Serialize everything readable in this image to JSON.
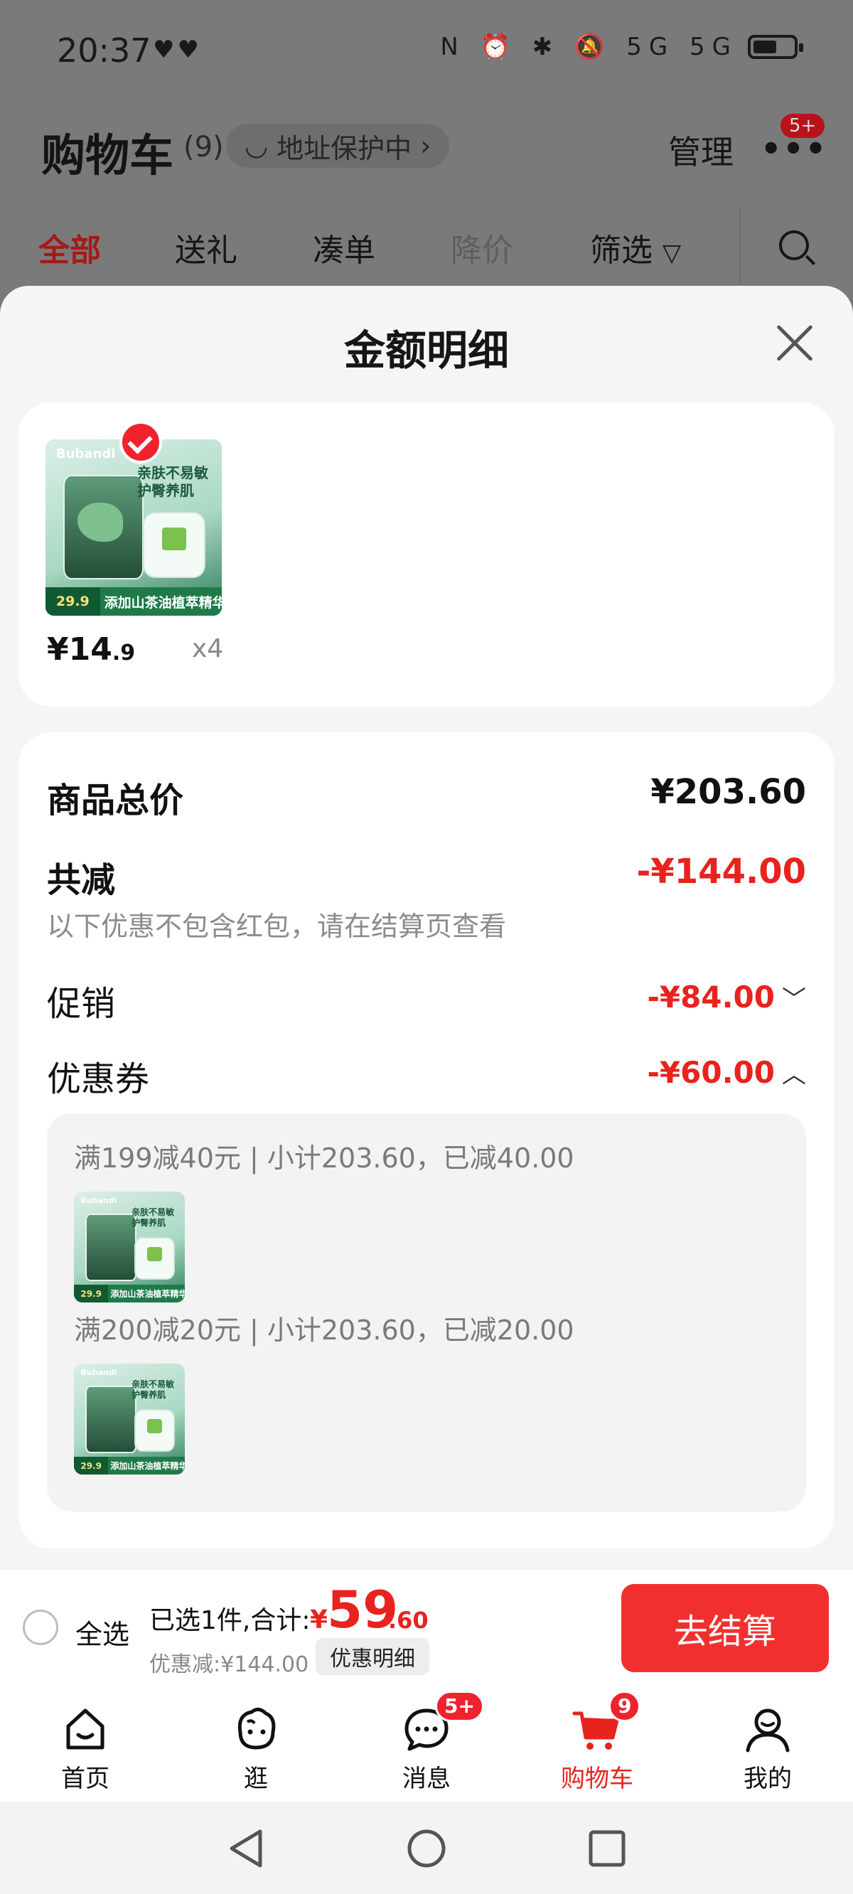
{
  "status_bar": {
    "time": "20:37",
    "hearts": "♥♥",
    "icons": "N ⏰ ✱ 🔕 5G 5G"
  },
  "header": {
    "title": "购物车",
    "count": "(9)",
    "address_pill": "地址保护中",
    "manage": "管理",
    "more_badge": "5+"
  },
  "filter_tabs": [
    {
      "label": "全部"
    },
    {
      "label": "送礼"
    },
    {
      "label": "凑单"
    },
    {
      "label": "降价"
    },
    {
      "label": "筛选"
    }
  ],
  "sheet": {
    "title": "金额明细",
    "product": {
      "brand": "Bubandi",
      "promo_text": "亲肤不易敏 护臀养肌",
      "bar_price": "29.9",
      "bar_text": "添加山茶油植萃精华",
      "price_int": "¥14",
      "price_dec": ".9",
      "qty": "x4"
    },
    "summary": {
      "total_label": "商品总价",
      "total_value": "¥203.60",
      "reduce_label": "共减",
      "reduce_value": "-¥144.00",
      "note": "以下优惠不包含红包，请在结算页查看",
      "promo_label": "促销",
      "promo_value": "-¥84.00",
      "promo_chevron": "﹀",
      "coupon_label": "优惠券",
      "coupon_value": "-¥60.00",
      "coupon_chevron": "︿"
    },
    "coupons": [
      {
        "text": "满199减40元 | 小计203.60，已减40.00"
      },
      {
        "text": "满200减20元 | 小计203.60，已减20.00"
      }
    ]
  },
  "checkout": {
    "select_all": "全选",
    "selected": "已选1件,合计:",
    "currency": "¥",
    "total_int": "59",
    "total_dec": ".60",
    "discount": "优惠减:¥144.00",
    "detail_button": "优惠明细",
    "checkout_button": "去结算"
  },
  "tabbar": [
    {
      "label": "首页"
    },
    {
      "label": "逛"
    },
    {
      "label": "消息",
      "badge": "5+"
    },
    {
      "label": "购物车",
      "badge": "9"
    },
    {
      "label": "我的"
    }
  ],
  "colors": {
    "accent": "#e8231d",
    "checkout": "#f22f2f",
    "sheet_bg": "#f5f5f5"
  }
}
